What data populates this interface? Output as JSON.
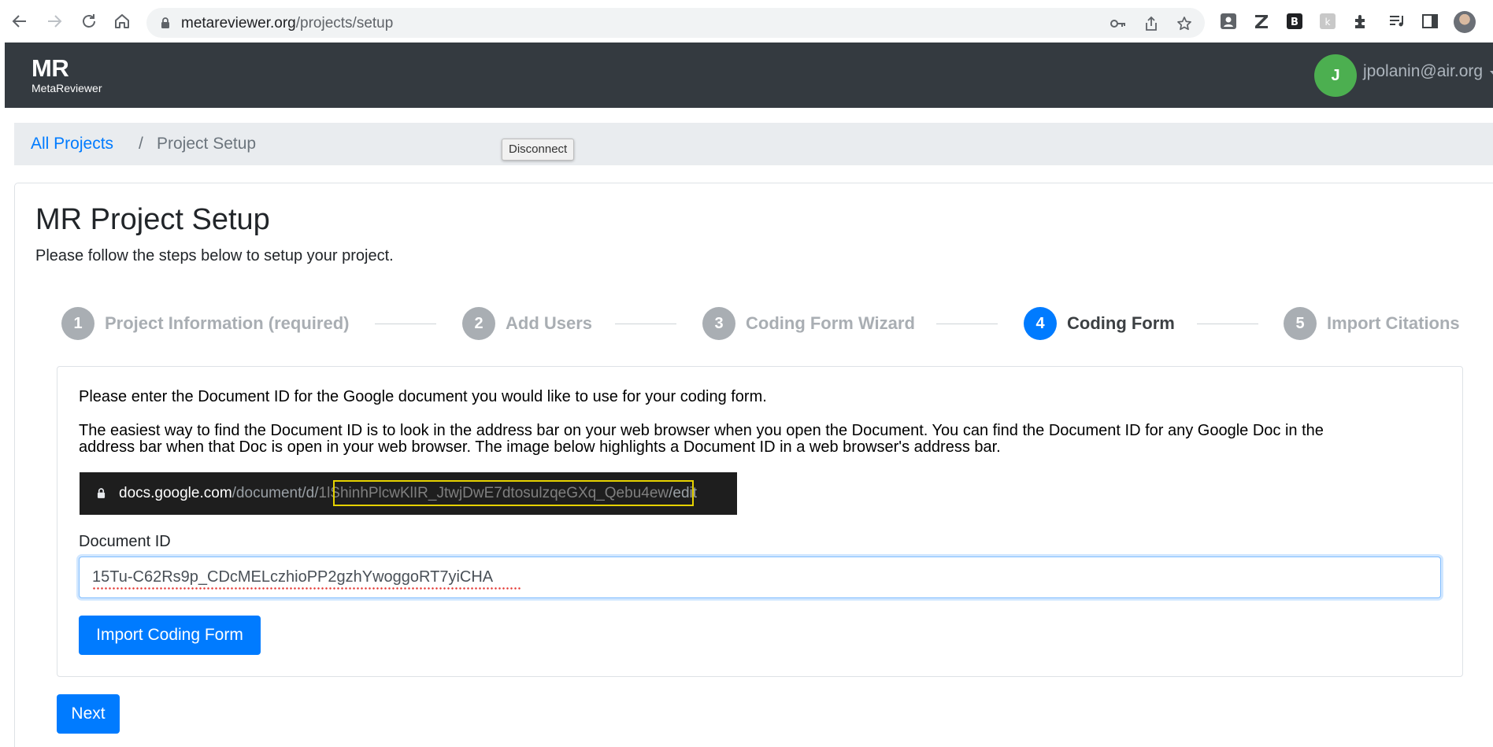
{
  "browser": {
    "url_host": "metareviewer.org",
    "url_path": "/projects/setup"
  },
  "app": {
    "brand_short": "MR",
    "brand_name": "MetaReviewer",
    "user_initial": "J",
    "user_email": "jpolanin@air.org"
  },
  "breadcrumb": {
    "link": "All Projects",
    "separator": "/",
    "active": "Project Setup"
  },
  "tooltip": {
    "text": "Disconnect"
  },
  "page": {
    "title": "MR Project Setup",
    "subtitle": "Please follow the steps below to setup your project."
  },
  "steps": [
    {
      "number": "1",
      "label": "Project Information (required)",
      "active": false
    },
    {
      "number": "2",
      "label": "Add Users",
      "active": false
    },
    {
      "number": "3",
      "label": "Coding Form Wizard",
      "active": false
    },
    {
      "number": "4",
      "label": "Coding Form",
      "active": true
    },
    {
      "number": "5",
      "label": "Import Citations",
      "active": false
    }
  ],
  "coding_form": {
    "intro": "Please enter the Document ID for the Google document you would like to use for your coding form.",
    "help_line1": "The easiest way to find the Document ID is to look in the address bar on your web browser when you open the Document. You can find the Document ID for any Google Doc in the",
    "help_line2": "address bar when that Doc is open in your web browser. The image below highlights a Document ID in a web browser's address bar.",
    "example_host": "docs.google.com",
    "example_prefix": "/document/d/",
    "example_docid": "1lShinhPlcwKlIR_JtwjDwE7dtosulzqeGXq_Qebu4ew",
    "example_suffix": "/edit",
    "field_label": "Document ID",
    "field_value": "15Tu-C62Rs9p_CDcMELczhioPP2gzhYwoggoRT7yiCHA",
    "import_button": "Import Coding Form"
  },
  "footer": {
    "next_button": "Next"
  },
  "colors": {
    "navbar": "#343a40",
    "primary": "#007bff",
    "avatar": "#4caf50",
    "step_inactive": "#a9aeb3",
    "highlight": "#e6d200"
  }
}
